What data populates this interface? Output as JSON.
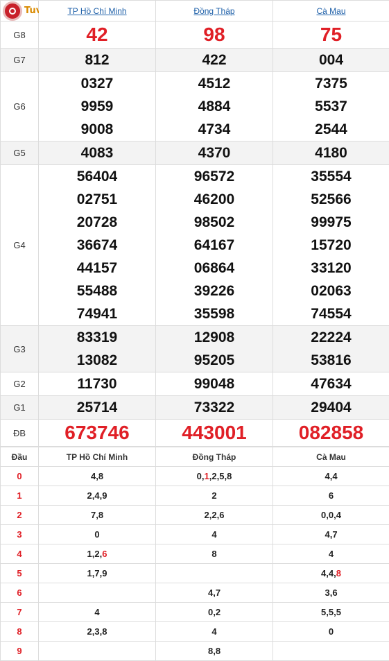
{
  "logo_text": "Tuvimoingay.vn",
  "provinces": [
    "TP Hồ Chí Minh",
    "Đồng Tháp",
    "Cà Mau"
  ],
  "prizes": [
    {
      "label": "G8",
      "values": [
        [
          "42"
        ],
        [
          "98"
        ],
        [
          "75"
        ]
      ]
    },
    {
      "label": "G7",
      "values": [
        [
          "812"
        ],
        [
          "422"
        ],
        [
          "004"
        ]
      ]
    },
    {
      "label": "G6",
      "values": [
        [
          "0327",
          "9959",
          "9008"
        ],
        [
          "4512",
          "4884",
          "4734"
        ],
        [
          "7375",
          "5537",
          "2544"
        ]
      ]
    },
    {
      "label": "G5",
      "values": [
        [
          "4083"
        ],
        [
          "4370"
        ],
        [
          "4180"
        ]
      ]
    },
    {
      "label": "G4",
      "values": [
        [
          "56404",
          "02751",
          "20728",
          "36674",
          "44157",
          "55488",
          "74941"
        ],
        [
          "96572",
          "46200",
          "98502",
          "64167",
          "06864",
          "39226",
          "35598"
        ],
        [
          "35554",
          "52566",
          "99975",
          "15720",
          "33120",
          "02063",
          "74554"
        ]
      ]
    },
    {
      "label": "G3",
      "values": [
        [
          "83319",
          "13082"
        ],
        [
          "12908",
          "95205"
        ],
        [
          "22224",
          "53816"
        ]
      ]
    },
    {
      "label": "G2",
      "values": [
        [
          "11730"
        ],
        [
          "99048"
        ],
        [
          "47634"
        ]
      ]
    },
    {
      "label": "G1",
      "values": [
        [
          "25714"
        ],
        [
          "73322"
        ],
        [
          "29404"
        ]
      ]
    },
    {
      "label": "ĐB",
      "values": [
        [
          "673746"
        ],
        [
          "443001"
        ],
        [
          "082858"
        ]
      ]
    }
  ],
  "loto": {
    "header_label": "Đầu",
    "columns": [
      "TP Hồ Chí Minh",
      "Đồng Tháp",
      "Cà Mau"
    ],
    "rows": [
      {
        "head": "0",
        "cells": [
          [
            {
              "t": "4"
            },
            {
              "t": "8"
            }
          ],
          [
            {
              "t": "0"
            },
            {
              "t": "1",
              "r": true
            },
            {
              "t": "2"
            },
            {
              "t": "5"
            },
            {
              "t": "8"
            }
          ],
          [
            {
              "t": "4"
            },
            {
              "t": "4"
            }
          ]
        ]
      },
      {
        "head": "1",
        "cells": [
          [
            {
              "t": "2"
            },
            {
              "t": "4"
            },
            {
              "t": "9"
            }
          ],
          [
            {
              "t": "2"
            }
          ],
          [
            {
              "t": "6"
            }
          ]
        ]
      },
      {
        "head": "2",
        "cells": [
          [
            {
              "t": "7"
            },
            {
              "t": "8"
            }
          ],
          [
            {
              "t": "2"
            },
            {
              "t": "2"
            },
            {
              "t": "6"
            }
          ],
          [
            {
              "t": "0"
            },
            {
              "t": "0"
            },
            {
              "t": "4"
            }
          ]
        ]
      },
      {
        "head": "3",
        "cells": [
          [
            {
              "t": "0"
            }
          ],
          [
            {
              "t": "4"
            }
          ],
          [
            {
              "t": "4"
            },
            {
              "t": "7"
            }
          ]
        ]
      },
      {
        "head": "4",
        "cells": [
          [
            {
              "t": "1"
            },
            {
              "t": "2"
            },
            {
              "t": "6",
              "r": true
            }
          ],
          [
            {
              "t": "8"
            }
          ],
          [
            {
              "t": "4"
            }
          ]
        ]
      },
      {
        "head": "5",
        "cells": [
          [
            {
              "t": "1"
            },
            {
              "t": "7"
            },
            {
              "t": "9"
            }
          ],
          [],
          [
            {
              "t": "4"
            },
            {
              "t": "4"
            },
            {
              "t": "8",
              "r": true
            }
          ]
        ]
      },
      {
        "head": "6",
        "cells": [
          [],
          [
            {
              "t": "4"
            },
            {
              "t": "7"
            }
          ],
          [
            {
              "t": "3"
            },
            {
              "t": "6"
            }
          ]
        ]
      },
      {
        "head": "7",
        "cells": [
          [
            {
              "t": "4"
            }
          ],
          [
            {
              "t": "0"
            },
            {
              "t": "2"
            }
          ],
          [
            {
              "t": "5"
            },
            {
              "t": "5"
            },
            {
              "t": "5"
            }
          ]
        ]
      },
      {
        "head": "8",
        "cells": [
          [
            {
              "t": "2"
            },
            {
              "t": "3"
            },
            {
              "t": "8"
            }
          ],
          [
            {
              "t": "4"
            }
          ],
          [
            {
              "t": "0"
            }
          ]
        ]
      },
      {
        "head": "9",
        "cells": [
          [],
          [
            {
              "t": "8"
            },
            {
              "t": "8"
            }
          ],
          []
        ]
      }
    ]
  }
}
